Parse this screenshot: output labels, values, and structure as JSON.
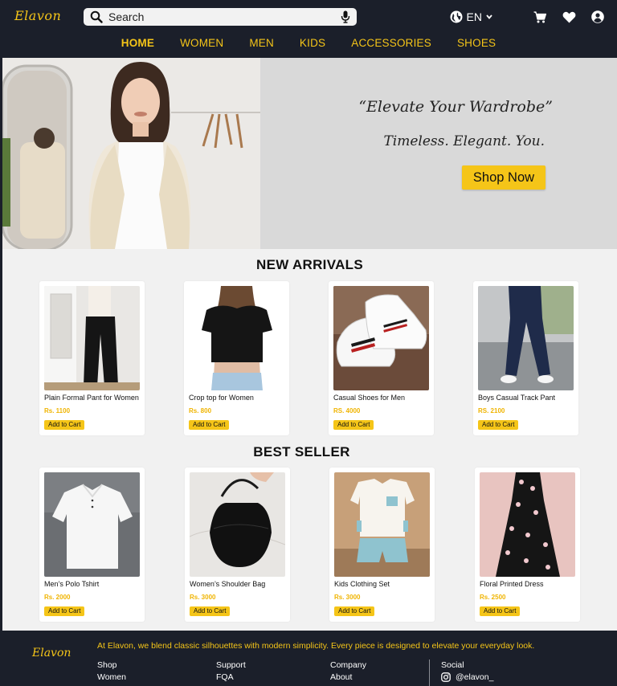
{
  "brand": {
    "name": "Elavon",
    "accent": "#f5c518",
    "dark_bg": "#1b1f2a"
  },
  "search": {
    "placeholder": "Search"
  },
  "language": {
    "selected": "EN"
  },
  "nav": {
    "items": [
      {
        "label": "HOME",
        "active": true
      },
      {
        "label": "WOMEN"
      },
      {
        "label": "MEN"
      },
      {
        "label": "KIDS"
      },
      {
        "label": "ACCESSORIES"
      },
      {
        "label": "SHOES"
      }
    ]
  },
  "hero": {
    "tagline": "“Elevate Your Wardrobe”",
    "subtagline": "Timeless. Elegant. You.",
    "cta": "Shop Now"
  },
  "new_arrivals": {
    "title": "NEW ARRIVALS",
    "products": [
      {
        "name": "Plain Formal Pant for Women",
        "price": "Rs. 1100",
        "cta": "Add to Cart"
      },
      {
        "name": "Crop top for Women",
        "price": "Rs. 800",
        "cta": "Add to Cart"
      },
      {
        "name": "Casual Shoes for Men",
        "price": "RS. 4000",
        "cta": "Add to Cart"
      },
      {
        "name": "Boys Casual Track Pant",
        "price": "RS. 2100",
        "cta": "Add to Cart"
      }
    ]
  },
  "best_seller": {
    "title": "BEST SELLER",
    "products": [
      {
        "name": "Men’s Polo Tshirt",
        "price": "Rs. 2000",
        "cta": "Add to Cart"
      },
      {
        "name": "Women’s Shoulder Bag",
        "price": "Rs. 3000",
        "cta": "Add to Cart"
      },
      {
        "name": "Kids Clothing Set",
        "price": "Rs. 3000",
        "cta": "Add to Cart"
      },
      {
        "name": "Floral Printed Dress",
        "price": "Rs. 2500",
        "cta": "Add to Cart"
      }
    ]
  },
  "footer": {
    "brand": "Elavon",
    "about": "At Elavon, we blend classic silhouettes with modern simplicity. Every piece is designed to elevate your everyday look.",
    "columns": [
      {
        "heading": "Shop",
        "links": [
          "Women"
        ]
      },
      {
        "heading": "Support",
        "links": [
          "FQA"
        ]
      },
      {
        "heading": "Company",
        "links": [
          "About"
        ]
      },
      {
        "heading": "Social",
        "links": [
          "@elavon_"
        ]
      }
    ]
  }
}
